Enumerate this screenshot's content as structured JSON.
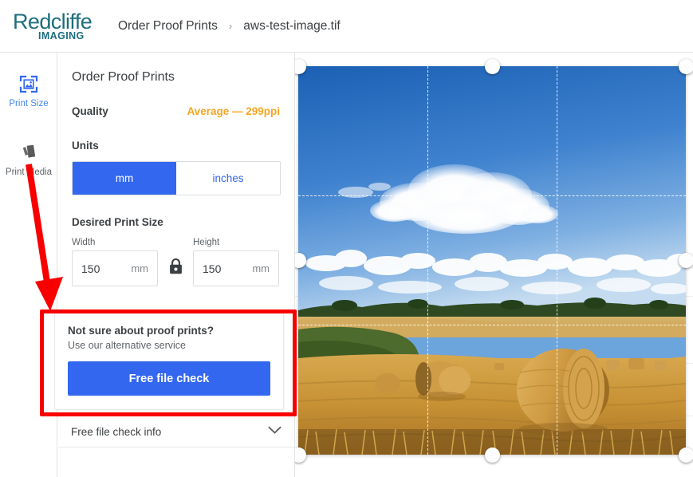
{
  "header": {
    "logo_main": "Redcliffe",
    "logo_sub": "IMAGING",
    "breadcrumb_root": "Order Proof Prints",
    "breadcrumb_separator": "›",
    "breadcrumb_current": "aws-test-image.tif"
  },
  "rail": {
    "items": [
      {
        "label": "Print Size",
        "icon": "image-crop-icon",
        "active": true
      },
      {
        "label": "Print Media",
        "icon": "media-stack-icon",
        "active": false
      }
    ]
  },
  "panel": {
    "title": "Order Proof Prints",
    "quality_label": "Quality",
    "quality_value": "Average — 299ppi",
    "quality_color": "#f5a623",
    "units_label": "Units",
    "units_options": [
      {
        "label": "mm",
        "selected": true
      },
      {
        "label": "inches",
        "selected": false
      }
    ],
    "size_label": "Desired Print Size",
    "width_caption": "Width",
    "width_value": "150",
    "width_unit": "mm",
    "height_caption": "Height",
    "height_value": "150",
    "height_unit": "mm",
    "lock_icon": "lock-closed-icon",
    "lock_state": "locked"
  },
  "promo": {
    "heading": "Not sure about proof prints?",
    "subtext": "Use our alternative service",
    "button_label": "Free file check",
    "button_color": "#3367f0",
    "highlight_color": "#f80000"
  },
  "accordion": {
    "label": "Free file check info",
    "chevron_icon": "chevron-down-icon",
    "expanded": false
  },
  "preview": {
    "image_description": "Harvested wheat field with large round straw bales under a blue sky with cumulus clouds",
    "crop_grid": "rule-of-thirds",
    "handles": [
      "top-left",
      "top-center",
      "top-right",
      "middle-left",
      "middle-right",
      "bottom-left",
      "bottom-center",
      "bottom-right"
    ]
  },
  "annotation": {
    "arrow_color": "#f80000",
    "arrow_target": "promo-card"
  }
}
